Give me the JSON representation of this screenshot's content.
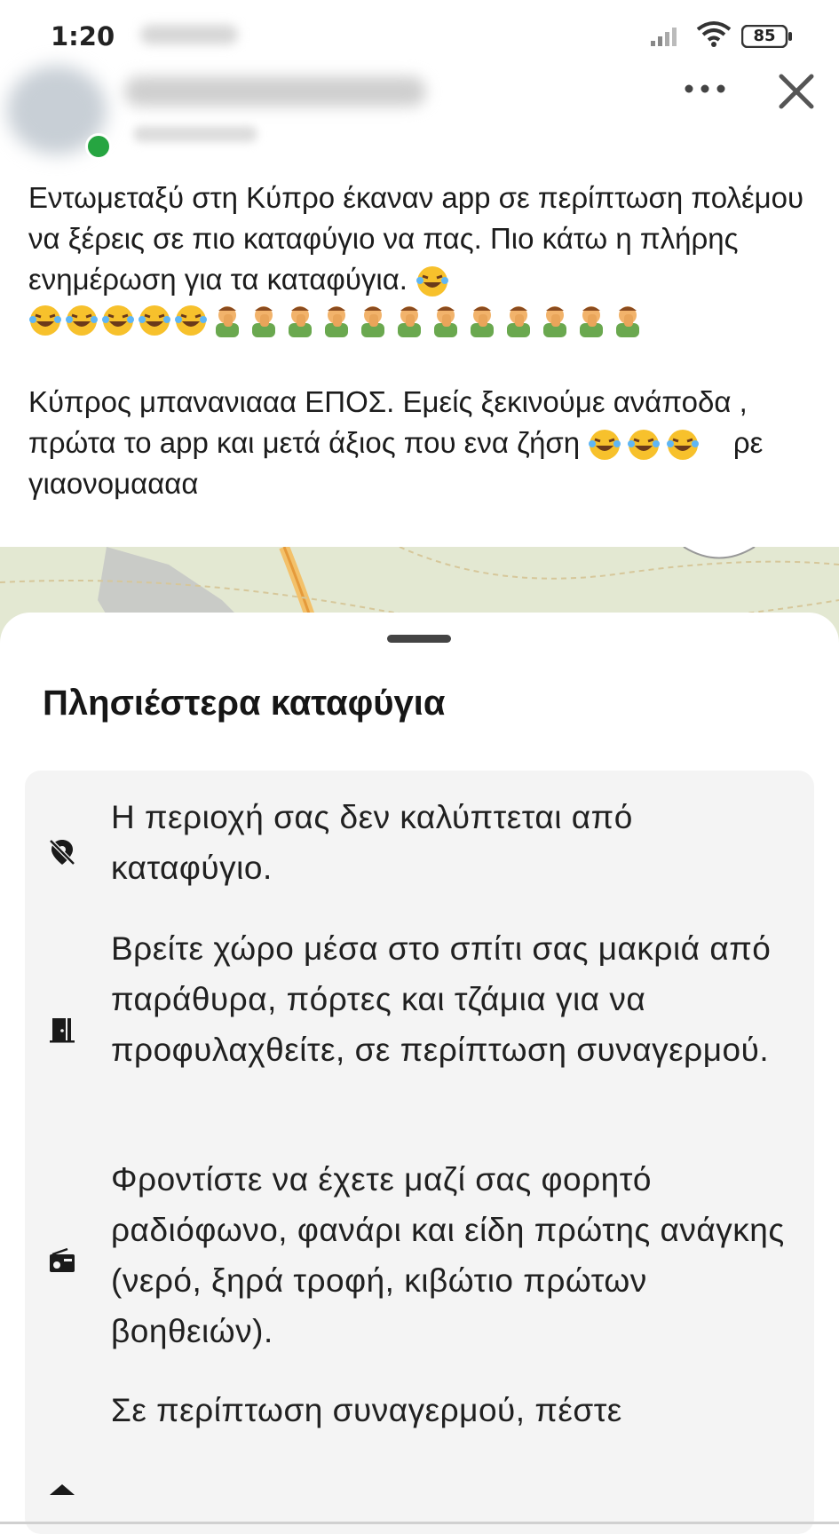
{
  "status_bar": {
    "time": "1:20",
    "battery": "85"
  },
  "post": {
    "text": [
      "Εντωμεταξύ στη Κύπρο έκαναν app σε περίπτωση πολέμου να ξέρεις σε πιο καταφύγιο να πας. Πιο κάτω η πλήρης ενημέρωση για τα καταφύγια.",
      "Κύπρος μπανανιααα ΕΠΟΣ. Εμείς ξεκινούμε ανάποδα , πρώτα το app  και μετά άξιος που ενα ζήση",
      "ρε γιαονομαααα"
    ],
    "emoji_laugh_count_row1": 5,
    "emoji_facepalm_count_row1": 12,
    "emoji_laugh_count_row2": 3
  },
  "sheet": {
    "title": "Πλησιέστερα καταφύγια",
    "items": [
      {
        "icon": "location-off-icon",
        "text": "Η περιοχή σας δεν καλύπτεται από καταφύγιο."
      },
      {
        "icon": "door-icon",
        "text": "Βρείτε χώρο μέσα στο σπίτι σας μακριά από παράθυρα, πόρτες και τζάμια για να προφυλαχθείτε, σε περίπτωση συναγερμού."
      },
      {
        "icon": "radio-icon",
        "text": "Φροντίστε να έχετε μαζί σας φορητό ραδιόφωνο, φανάρι και είδη πρώτης ανάγκης (νερό, ξηρά τροφή, κιβώτιο πρώτων βοηθειών)."
      },
      {
        "icon": "info-icon",
        "text": "Σε περίπτωση συναγερμού, πέστε"
      }
    ]
  },
  "colors": {
    "online": "#26a541",
    "emoji_laugh": "#f7c12c",
    "emoji_facepalm_shirt": "#6aa84f",
    "sheet_card": "#f4f4f4"
  }
}
